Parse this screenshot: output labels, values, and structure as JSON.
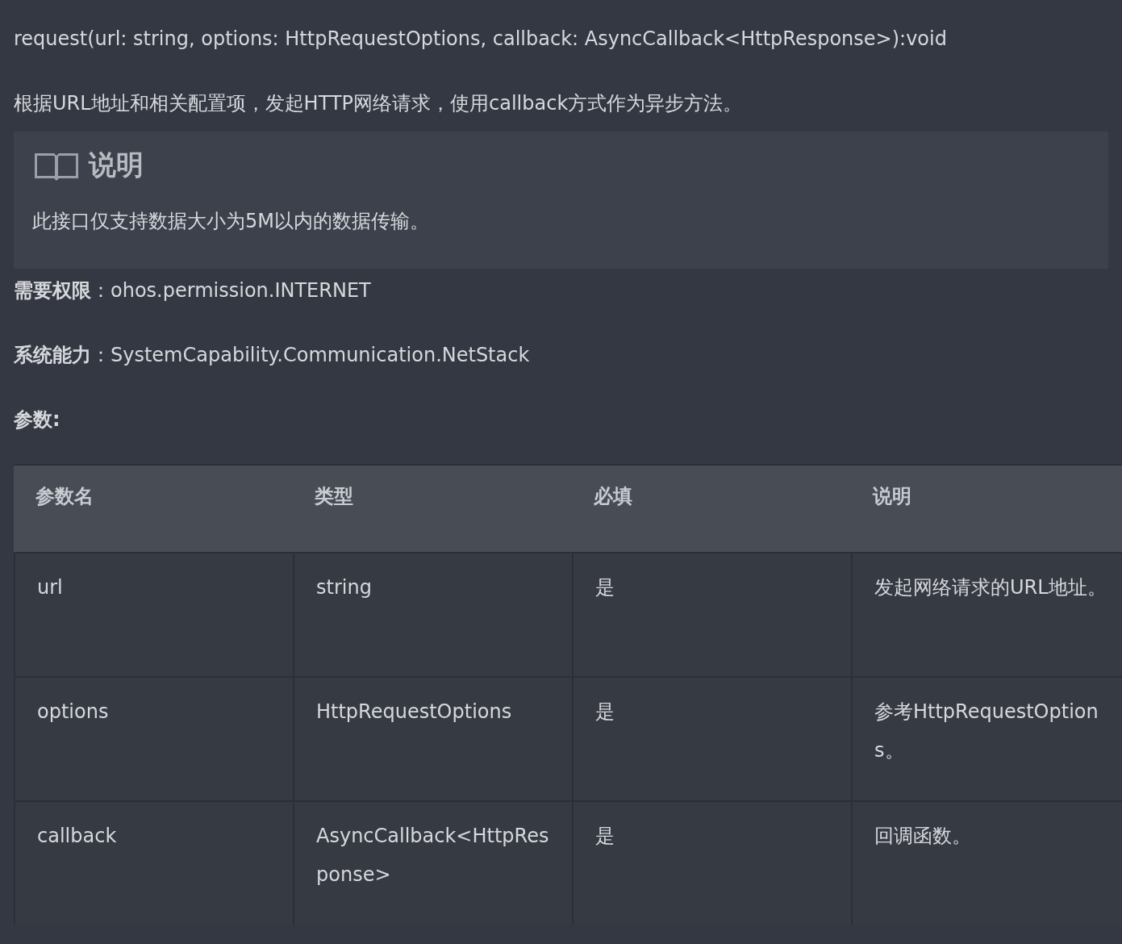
{
  "signature": "request(url: string, options: HttpRequestOptions, callback: AsyncCallback<HttpResponse>):void",
  "description": "根据URL地址和相关配置项，发起HTTP网络请求，使用callback方式作为异步方法。",
  "note": {
    "title": "说明",
    "text": "此接口仅支持数据大小为5M以内的数据传输。"
  },
  "properties": [
    "**需要权限**：ohos.permission.INTERNET",
    "**系统能力**：SystemCapability.Communication.NetStack"
  ],
  "params_heading": "参数:",
  "table": {
    "columns": [
      "参数名",
      "类型",
      "必填",
      "说明"
    ],
    "rows": [
      [
        "url",
        "string",
        "是",
        "发起网络请求的URL地址。"
      ],
      [
        "options",
        "HttpRequestOptions",
        "是",
        "参考HttpRequestOptions。"
      ],
      [
        "callback",
        "AsyncCallback<HttpResponse>",
        "是",
        "回调函数。"
      ]
    ]
  }
}
